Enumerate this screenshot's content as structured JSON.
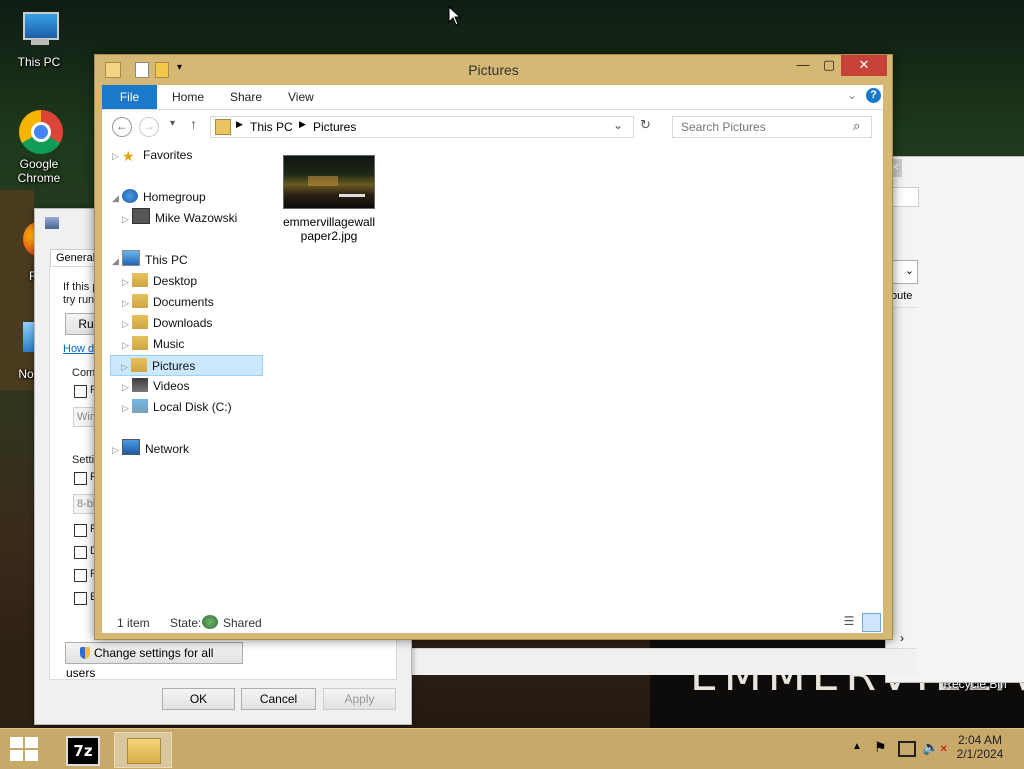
{
  "desktop": {
    "icons": [
      {
        "label": "This PC"
      },
      {
        "label": "Google Chrome"
      },
      {
        "label": "Fir"
      },
      {
        "label": "NoEsc"
      },
      {
        "label": "Recycle Bin"
      }
    ],
    "wallpaper_text": "EMMERVILLA"
  },
  "props_dialog": {
    "tab": "General",
    "line1": "If this p",
    "line2": "try runn",
    "run_btn": "Ru",
    "link": "How d",
    "group1": "Com",
    "group2": "Setti",
    "combo1": "Win",
    "combo2": "8-bi",
    "check_labels": [
      "F",
      "F",
      "F",
      "D",
      "F",
      "E"
    ],
    "change_btn": "Change settings for all users",
    "ok": "OK",
    "cancel": "Cancel",
    "apply": "Apply"
  },
  "bg_window": {
    "col_header": "oute"
  },
  "explorer": {
    "title": "Pictures",
    "tabs": {
      "file": "File",
      "home": "Home",
      "share": "Share",
      "view": "View"
    },
    "breadcrumb": [
      "This PC",
      "Pictures"
    ],
    "search_placeholder": "Search Pictures",
    "nav": {
      "favorites": "Favorites",
      "homegroup": "Homegroup",
      "user": "Mike Wazowski",
      "this_pc": "This PC",
      "desktop": "Desktop",
      "documents": "Documents",
      "downloads": "Downloads",
      "music": "Music",
      "pictures": "Pictures",
      "videos": "Videos",
      "local_disk": "Local Disk (C:)",
      "network": "Network"
    },
    "file": {
      "name_line1": "emmervillagewall",
      "name_line2": "paper2.jpg"
    },
    "status": {
      "count": "1 item",
      "state_label": "State:",
      "state_value": "Shared"
    }
  },
  "taskbar": {
    "apps": [
      "7z",
      "File Explorer"
    ],
    "time": "2:04 AM",
    "date": "2/1/2024"
  }
}
